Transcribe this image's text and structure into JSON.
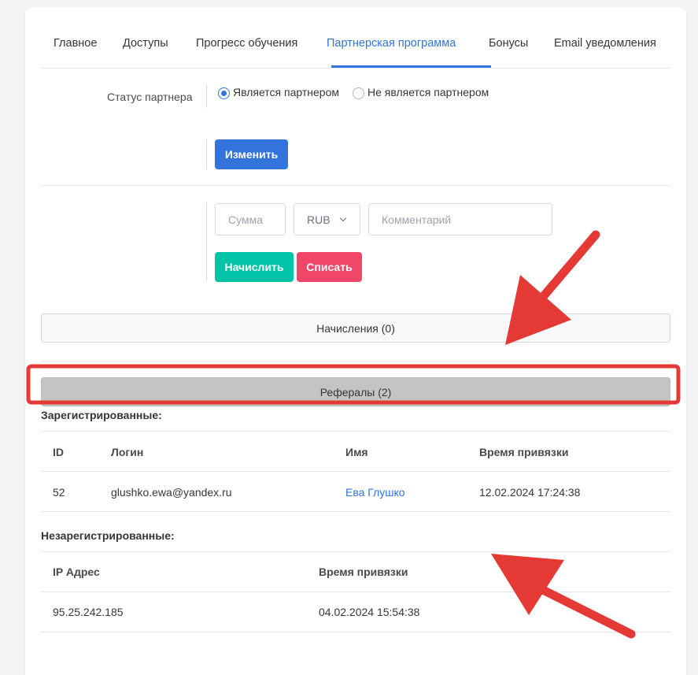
{
  "tabs": [
    {
      "label": "Главное"
    },
    {
      "label": "Доступы"
    },
    {
      "label": "Прогресс обучения"
    },
    {
      "label": "Партнерская программа"
    },
    {
      "label": "Бонусы"
    },
    {
      "label": "Email уведомления"
    }
  ],
  "active_tab": "Партнерская программа",
  "partner_status": {
    "label": "Статус партнера",
    "options": [
      {
        "label": "Является партнером",
        "checked": true
      },
      {
        "label": "Не является партнером",
        "checked": false
      }
    ],
    "change_button": "Изменить"
  },
  "transaction": {
    "amount_placeholder": "Сумма",
    "currency": "RUB",
    "comment_placeholder": "Комментарий",
    "credit_button": "Начислить",
    "debit_button": "Списать"
  },
  "accruals_button": "Начисления (0)",
  "referrals_button": "Рефералы (2)",
  "registered": {
    "title": "Зарегистрированные:",
    "columns": [
      "ID",
      "Логин",
      "Имя",
      "Время привязки"
    ],
    "rows": [
      {
        "id": "52",
        "login": "glushko.ewa@yandex.ru",
        "name": "Ева Глушко",
        "time": "12.02.2024 17:24:38"
      }
    ]
  },
  "unregistered": {
    "title": "Незарегистрированные:",
    "columns": [
      "IP Адрес",
      "Время привязки"
    ],
    "rows": [
      {
        "ip": "95.25.242.185",
        "time": "04.02.2024 15:54:38"
      }
    ]
  },
  "colors": {
    "accent": "#3273dc",
    "success": "#00c4a7",
    "danger": "#f14668",
    "annotation": "#e53935",
    "referrals_bg": "#c4c4c4"
  }
}
